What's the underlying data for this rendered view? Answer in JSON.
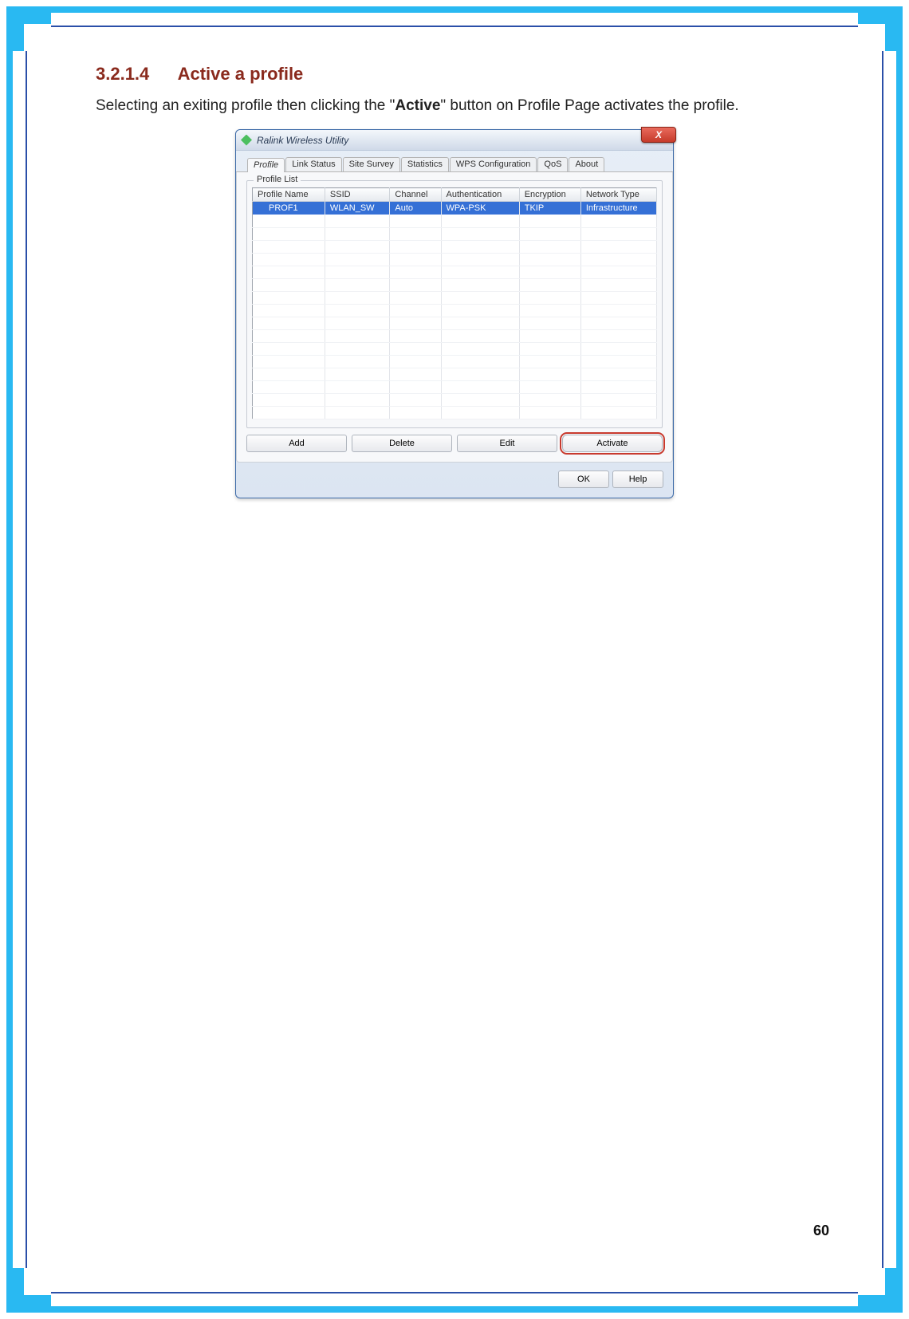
{
  "doc": {
    "section_number": "3.2.1.4",
    "section_title": "Active a profile",
    "paragraph_prefix": "Selecting an exiting profile then clicking the \"",
    "paragraph_bold": "Active",
    "paragraph_suffix": "\" button on Profile Page activates the profile."
  },
  "dialog": {
    "title": "Ralink Wireless Utility",
    "close_label": "X",
    "tabs": [
      "Profile",
      "Link Status",
      "Site Survey",
      "Statistics",
      "WPS Configuration",
      "QoS",
      "About"
    ],
    "active_tab": "Profile",
    "group_title": "Profile List",
    "columns": [
      "Profile Name",
      "SSID",
      "Channel",
      "Authentication",
      "Encryption",
      "Network Type"
    ],
    "rows": [
      {
        "Profile Name": "PROF1",
        "SSID": "WLAN_SW",
        "Channel": "Auto",
        "Authentication": "WPA-PSK",
        "Encryption": "TKIP",
        "Network Type": "Infrastructure",
        "selected": true
      }
    ],
    "action_buttons": {
      "add": "Add",
      "delete": "Delete",
      "edit": "Edit",
      "activate": "Activate"
    },
    "footer_buttons": {
      "ok": "OK",
      "help": "Help"
    }
  },
  "page_number": "60"
}
